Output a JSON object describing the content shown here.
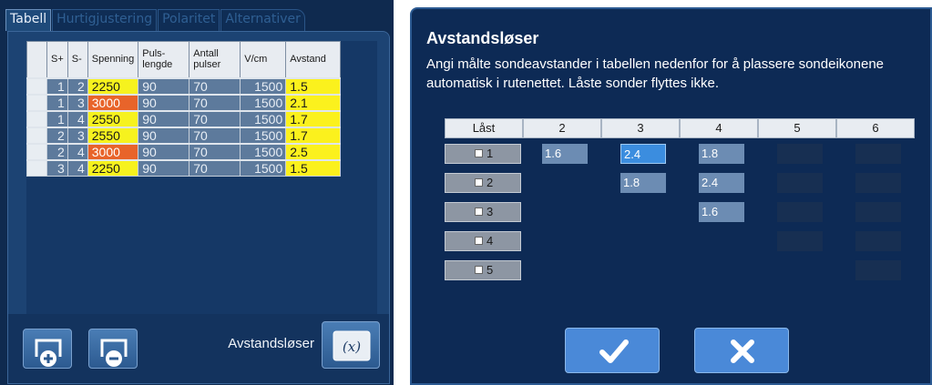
{
  "left_panel": {
    "tabs": [
      {
        "label": "Tabell",
        "active": true
      },
      {
        "label": "Hurtigjustering",
        "active": false
      },
      {
        "label": "Polaritet",
        "active": false
      },
      {
        "label": "Alternativer",
        "active": false
      }
    ],
    "table": {
      "headers": [
        "S+",
        "S-",
        "Spenning",
        "Puls-\nlengde",
        "Antall\npulser",
        "V/cm",
        "Avstand"
      ],
      "rows": [
        {
          "s_plus": "1",
          "s_minus": "2",
          "spenning": "2250",
          "spenning_state": "normal",
          "pulslengde": "90",
          "antall": "70",
          "vcm": "1500",
          "avstand": "1.5"
        },
        {
          "s_plus": "1",
          "s_minus": "3",
          "spenning": "3000",
          "spenning_state": "warning",
          "pulslengde": "90",
          "antall": "70",
          "vcm": "1500",
          "avstand": "2.1"
        },
        {
          "s_plus": "1",
          "s_minus": "4",
          "spenning": "2550",
          "spenning_state": "normal",
          "pulslengde": "90",
          "antall": "70",
          "vcm": "1500",
          "avstand": "1.7"
        },
        {
          "s_plus": "2",
          "s_minus": "3",
          "spenning": "2550",
          "spenning_state": "normal",
          "pulslengde": "90",
          "antall": "70",
          "vcm": "1500",
          "avstand": "1.7"
        },
        {
          "s_plus": "2",
          "s_minus": "4",
          "spenning": "3000",
          "spenning_state": "warning",
          "pulslengde": "90",
          "antall": "70",
          "vcm": "1500",
          "avstand": "2.5"
        },
        {
          "s_plus": "3",
          "s_minus": "4",
          "spenning": "2250",
          "spenning_state": "normal",
          "pulslengde": "90",
          "antall": "70",
          "vcm": "1500",
          "avstand": "1.5"
        }
      ]
    },
    "bottom": {
      "add_icon": "add-row-icon",
      "remove_icon": "remove-row-icon",
      "solver_label": "Avstandsløser",
      "solver_icon": "function-x-icon"
    },
    "colors": {
      "warning": "#e8642a",
      "highlight": "#f6f21e",
      "cell": "#5d7a9c"
    }
  },
  "dialog": {
    "title": "Avstandsløser",
    "description": "Angi målte sondeavstander i tabellen nedenfor for å plassere sondeikonene automatisk i rutenettet. Låste sonder flyttes ikke.",
    "lock_header": "Låst",
    "column_headers": [
      "2",
      "3",
      "4",
      "5",
      "6"
    ],
    "rows": [
      {
        "label": "1",
        "cells": [
          "1.6",
          "2.4",
          "1.8",
          "",
          ""
        ]
      },
      {
        "label": "2",
        "cells": [
          null,
          "1.8",
          "2.4",
          "",
          ""
        ]
      },
      {
        "label": "3",
        "cells": [
          null,
          null,
          "1.6",
          "",
          ""
        ]
      },
      {
        "label": "4",
        "cells": [
          null,
          null,
          null,
          "",
          ""
        ]
      },
      {
        "label": "5",
        "cells": [
          null,
          null,
          null,
          null,
          ""
        ]
      }
    ],
    "active_cell": "1-3",
    "confirm_icon": "checkmark-icon",
    "cancel_icon": "close-icon"
  }
}
